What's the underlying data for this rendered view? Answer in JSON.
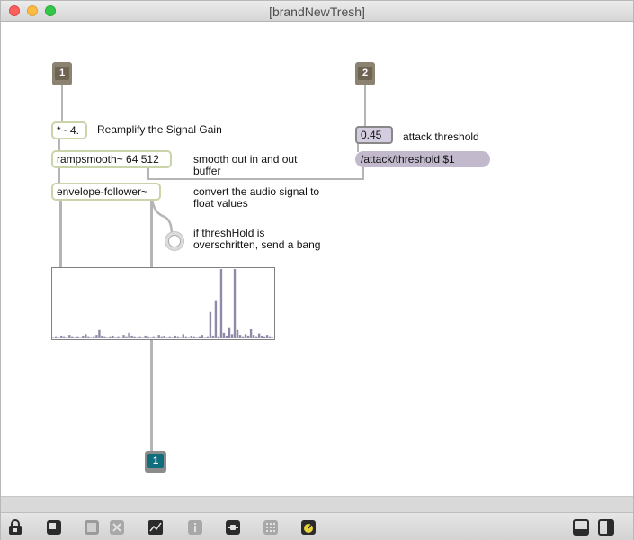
{
  "window": {
    "title": "[brandNewTresh]"
  },
  "patch": {
    "inlet_1": "1",
    "inlet_2": "2",
    "outlet_1": "1",
    "objects": {
      "multiply": "*~ 4.",
      "rampsmooth": "rampsmooth~ 64 512",
      "envelope": "envelope-follower~"
    },
    "number_value": "0.45",
    "message_text": "/attack/threshold $1",
    "comments": {
      "reamplify": "Reamplify the Signal Gain",
      "smooth_line1": "smooth out in and out",
      "smooth_line2": "buffer",
      "convert_line1": "convert the audio signal to",
      "convert_line2": "float values",
      "threshold_line1": "if threshHold is",
      "threshold_line2": "overschritten, send a bang",
      "attack": "attack threshold"
    }
  },
  "scope": {
    "description_values": [
      0.02,
      0.03,
      0.02,
      0.04,
      0.03,
      0.02,
      0.05,
      0.03,
      0.02,
      0.03,
      0.02,
      0.04,
      0.06,
      0.03,
      0.02,
      0.03,
      0.05,
      0.12,
      0.04,
      0.03,
      0.02,
      0.03,
      0.04,
      0.02,
      0.03,
      0.02,
      0.05,
      0.03,
      0.08,
      0.04,
      0.03,
      0.02,
      0.03,
      0.02,
      0.04,
      0.03,
      0.02,
      0.03,
      0.02,
      0.05,
      0.03,
      0.04,
      0.02,
      0.03,
      0.02,
      0.04,
      0.03,
      0.02,
      0.06,
      0.03,
      0.02,
      0.04,
      0.03,
      0.02,
      0.03,
      0.05,
      0.02,
      0.03,
      0.38,
      0.04,
      0.55,
      0.03,
      1.0,
      0.08,
      0.04,
      0.16,
      0.06,
      1.0,
      0.12,
      0.05,
      0.03,
      0.06,
      0.04,
      0.14,
      0.05,
      0.03,
      0.07,
      0.04,
      0.03,
      0.05,
      0.03,
      0.02
    ],
    "color": "#8f8aa8"
  },
  "toolbar": {
    "icons": [
      "lock-icon",
      "presentation-icon",
      "group-icon",
      "delete-icon",
      "debug-icon",
      "info-icon",
      "connect-icon",
      "grid-icon",
      "audio-icon",
      "left-panel-icon",
      "right-panel-icon"
    ]
  }
}
